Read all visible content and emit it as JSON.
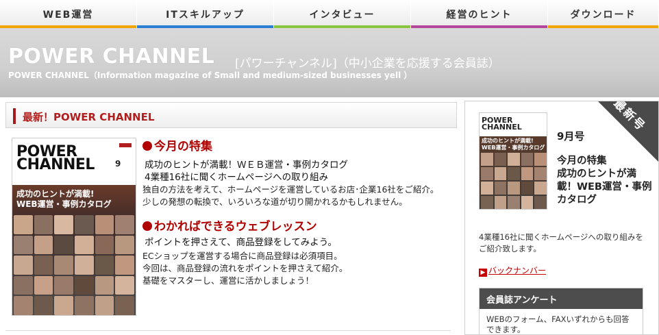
{
  "nav": {
    "items": [
      {
        "label": "WEB運営",
        "color": "#f0a500"
      },
      {
        "label": "ITスキルアップ",
        "color": "#2a7fd4"
      },
      {
        "label": "インタビュー",
        "color": "#8cc63f"
      },
      {
        "label": "経営のヒント",
        "color": "#b5479b"
      },
      {
        "label": "ダウンロード",
        "color": "#f0a500"
      }
    ]
  },
  "header": {
    "title": "POWER CHANNEL",
    "subtitle": "[パワーチャンネル]（中小企業を応援する会員誌）",
    "english": "POWER CHANNEL（Information magazine of Small and medium-sized businesses yell ）"
  },
  "main": {
    "section_title": "最新！POWER CHANNEL",
    "cover": {
      "title_line1": "POWER",
      "title_line2": "CHANNEL",
      "issue": "9",
      "headline1": "成功のヒントが満載!",
      "headline2": "WEB運営・事例カタログ"
    },
    "article1": {
      "heading": "今月の特集",
      "line1": "成功のヒントが満載！ＷＥＢ運営・事例カタログ",
      "line2": "4業種16社に聞くホームページへの取り組み",
      "body1": "独自の方法を考えて、ホームページを運営しているお店･企業16社をご紹介。",
      "body2": "少しの発想の転換で、いろいろな道が切り開かれるかもしれません。"
    },
    "article2": {
      "heading": "わかればできるウェブレッスン",
      "line1": "ポイントを押さえて、商品登録をしてみよう。",
      "body1": "ECショップを運営する場合に商品登録は必須項目。",
      "body2": "今回は、商品登録の流れをポイントを押さえて紹介。",
      "body3": "基礎をマスターし、運営に活かしましょう！"
    }
  },
  "side": {
    "badge": "最新号",
    "thumb_title1": "POWER",
    "thumb_title2": "CHANNEL",
    "thumb_head": "成功のヒントが満載!\nWEB運営・事例カタログ",
    "issue": "9月号",
    "feature": "今月の特集\n成功のヒントが満載！WEB運営・事例カタログ",
    "desc": "4業種16社に聞くホームページへの取り組みをご紹介致します。",
    "backnumber": "バックナンバー",
    "survey_title": "会員誌アンケート",
    "survey_body": "WEBのフォーム、FAXいずれからも回答できます。"
  }
}
